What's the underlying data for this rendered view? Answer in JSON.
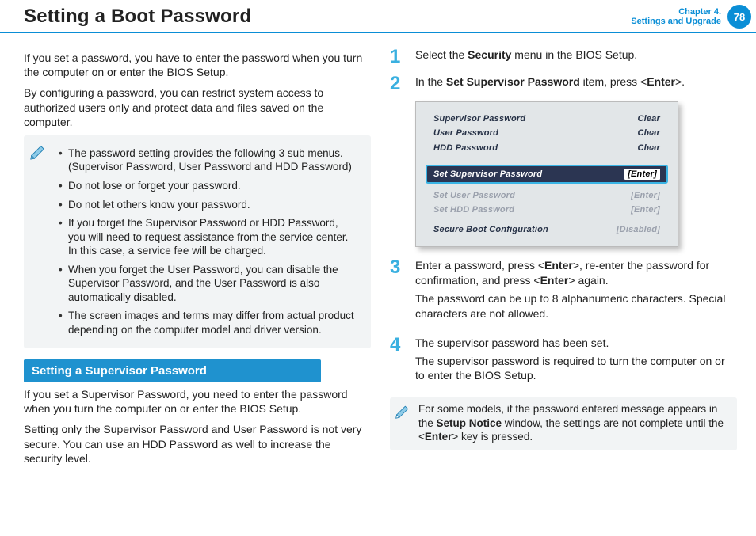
{
  "header": {
    "title": "Setting a Boot Password",
    "chapter_line1": "Chapter 4.",
    "chapter_line2": "Settings and Upgrade",
    "page_num": "78"
  },
  "left": {
    "intro1": "If you set a password, you have to enter the password when you turn the computer on or enter the BIOS Setup.",
    "intro2": "By configuring a password, you can restrict system access to authorized users only and protect data and files saved on the computer.",
    "notes": [
      "The password setting provides the following 3 sub menus. (Supervisor Password, User Password and HDD Password)",
      "Do not lose or forget your password.",
      "Do not let others know your password.",
      "If you forget the Supervisor Password or HDD Password, you will need to request assistance from the service center. In this case, a service fee will be charged.",
      "When you forget the User Password, you can disable the Supervisor Password, and the User Password is also automatically disabled.",
      "The screen images and terms may differ from actual product depending on the computer model and driver version."
    ],
    "subhead": "Setting a Supervisor Password",
    "sup1": "If you set a Supervisor Password, you need to enter the password when you turn the computer on or enter the BIOS Setup.",
    "sup2": "Setting only the Supervisor Password and User Password is not very secure. You can use an HDD Password as well to increase the security level."
  },
  "right": {
    "step1_pre": "Select the ",
    "step1_bold": "Security",
    "step1_post": " menu in the BIOS Setup.",
    "step2_pre": "In the ",
    "step2_bold": "Set Supervisor Password",
    "step2_mid": " item, press <",
    "step2_enter": "Enter",
    "step2_post": ">.",
    "bios": {
      "rows_top": [
        {
          "label": "Supervisor Password",
          "value": "Clear"
        },
        {
          "label": "User Password",
          "value": "Clear"
        },
        {
          "label": "HDD Password",
          "value": "Clear"
        }
      ],
      "highlight": {
        "label": "Set Supervisor Password",
        "value": "[Enter]"
      },
      "rows_mid": [
        {
          "label": "Set User Password",
          "value": "[Enter]"
        },
        {
          "label": "Set HDD Password",
          "value": "[Enter]"
        }
      ],
      "rows_bot": [
        {
          "label": "Secure Boot Configuration",
          "value": "[Disabled]"
        }
      ]
    },
    "step3a_pre": "Enter a password, press <",
    "step3a_e1": "Enter",
    "step3a_mid": ">, re-enter the password for confirmation, and press <",
    "step3a_e2": "Enter",
    "step3a_post": "> again.",
    "step3b": "The password can be up to 8 alphanumeric characters. Special characters are not allowed.",
    "step4a": "The supervisor password has been set.",
    "step4b": "The supervisor password is required to turn the computer on or to enter the BIOS Setup.",
    "footnote_pre": "For some models, if the password entered message appears in the ",
    "footnote_bold": "Setup Notice",
    "footnote_mid": " window, the settings are not complete until the <",
    "footnote_enter": "Enter",
    "footnote_post": "> key is pressed."
  }
}
